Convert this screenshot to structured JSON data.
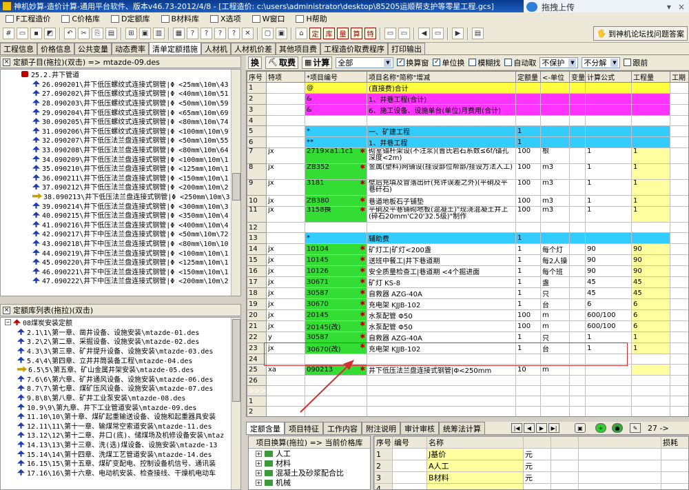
{
  "title_bar": {
    "text": "神机妙算-造价计算-通用平台软件、版本v46.73-2012/4/8 - [工程造价: c:\\users\\administrator\\desktop\\85205运顺帮支护等零星工程.gcs]"
  },
  "cloud": {
    "label": "拖拽上传"
  },
  "menu": [
    "F工程造价",
    "C价格库",
    "D定额库",
    "B材料库",
    "X选项",
    "W窗口",
    "H帮助"
  ],
  "forum_button": "到神机论坛找问题答案",
  "main_tabs": [
    "工程信息",
    "价格信息",
    "公共变量",
    "动态费率",
    "清单定额措施",
    "人材机",
    "人材机价差",
    "其他项目费",
    "工程造价取费程序",
    "打印输出"
  ],
  "active_main_tab": "清单定额措施",
  "left_top": {
    "header": "定额子目(拖拉)(双击) => mtazde-09.des",
    "root": "25.2.井下管道",
    "items": [
      "26.090201\\井下低压螺纹式连接式钢管|Φ <25mm\\10m\\43",
      "27.090202\\井下低压螺纹式连接式钢管|Φ <40mm\\10m\\51",
      "28.090203\\井下低压螺纹式连接式钢管|Φ <50mm\\10m\\59",
      "29.090204\\井下低压螺纹式连接式钢管|Φ <65mm\\10m\\69",
      "30.090205\\井下低压螺纹式连接式钢管|Φ <80mm\\10m\\74",
      "31.090206\\井下低压螺纹式连接式钢管|Φ <100mm\\10m\\9",
      "32.090207\\井下低压法兰盘连接式钢管|Φ <50mm\\10m\\55",
      "33.090208\\井下低压法兰盘连接式钢管|Φ <80mm\\10m\\64",
      "34.090209\\井下低压法兰盘连接式钢管|Φ <100mm\\10m\\1",
      "35.090210\\井下低压法兰盘连接式钢管|Φ <125mm\\10m\\1",
      "36.090211\\井下低压法兰盘连接式钢管|Φ <150mm\\10m\\1",
      "37.090212\\井下低压法兰盘连接式钢管|Φ <200mm\\10m\\2",
      "38.090213\\井下低压法兰盘连接式钢管|Φ <250mm\\10m\\3",
      "39.090214\\井下低压法兰盘连接式钢管|Φ <300mm\\10m\\3",
      "40.090215\\井下低压法兰盘连接式钢管|Φ <350mm\\10m\\4",
      "41.090216\\井下低压法兰盘连接式钢管|Φ <400mm\\10m\\4",
      "42.090217\\井下中压法兰盘连接式钢管|Φ <50mm\\10m\\72",
      "43.090218\\井下中压法兰盘连接式钢管|Φ <80mm\\10m\\10",
      "44.090219\\井下中压法兰盘连接式钢管|Φ <100mm\\10m\\1",
      "45.090220\\井下中压法兰盘连接式钢管|Φ <125mm\\10m\\1",
      "46.090221\\井下中压法兰盘连接式钢管|Φ <150mm\\10m\\1",
      "47.090222\\井下中压法兰盘连接式钢管|Φ <200mm\\10m\\2"
    ],
    "pointer_index": 12
  },
  "left_bottom": {
    "header": "定额库列表(拖拉)(双击)",
    "root": "08煤炭安装定额",
    "items": [
      "2.1\\1\\第一章、凿井设备、设施安装\\mtazde-01.des",
      "3.2\\2\\第二章、采掘设备、设施安装\\mtazde-02.des",
      "4.3\\3\\第三章、矿井提升设备、设施安装\\mtazde-03.des",
      "5.4\\4\\第四章、立井井筒装备工程\\mtazde-04.des",
      "6.5\\5\\第五章、矿山金属井架安装\\mtazde-05.des",
      "7.6\\6\\第六章、矿井通风设备、设施安装\\mtazde-06.des",
      "8.7\\7\\第七章、煤矿压风设备、设施安装\\mtazde-07.des",
      "9.8\\8\\第八章、矿井工业泵安装\\mtazde-08.des",
      "10.9\\9\\第九章、井下工业管道安装\\mtazde-09.des",
      "11.10\\10\\第十章、煤矿起重输送设备、设施和起重器具安装",
      "12.11\\11\\第十一章、输煤常空索道安装\\mtazde-11.des",
      "13.12\\12\\第十二章、井口(底)、储煤场及机修设备安装\\mtaz",
      "14.13\\13\\第十三章、洗(选)煤设备、设施安装\\mtazde-13",
      "15.14\\14\\第十四章、洗煤工艺管道安装\\mtazde-14.des",
      "16.15\\15\\第十五章、煤矿变配电、控制设备机信号、通讯装",
      "17.16\\16\\第十六章、电动机安装、检查接线、干燥机电动车"
    ],
    "pointer_index": 4
  },
  "right_toolbar": {
    "btn_swap": "换",
    "btn_fetch": "取费",
    "btn_calc": "计算",
    "filter_value": "全部",
    "checks": [
      {
        "label": "换算窗",
        "checked": true
      },
      {
        "label": "单位换",
        "checked": true
      },
      {
        "label": "模糊找",
        "checked": false
      },
      {
        "label": "自动取",
        "checked": false
      }
    ],
    "protect": "不保护",
    "split": "不分解",
    "follow": {
      "label": "跟前",
      "checked": false
    }
  },
  "grid": {
    "columns": [
      "序号",
      "特项",
      "*项目编号",
      "项目名称\"简称\"增减",
      "定额量",
      "<-单位",
      "变量",
      "计算公式",
      "工程量",
      "工期"
    ],
    "rows": [
      {
        "n": "1",
        "sp": "",
        "code": "@",
        "name": "(直接费)合计",
        "qty": "",
        "unit": "",
        "var": "",
        "formula": "",
        "amount": "",
        "style": "yel"
      },
      {
        "n": "2",
        "sp": "",
        "code": "&",
        "name": "1、井巷工程(合计)",
        "qty": "",
        "unit": "",
        "var": "",
        "formula": "",
        "amount": "",
        "style": "mag"
      },
      {
        "n": "3",
        "sp": "",
        "code": "&",
        "name": "6、施工设备、设施单台(单位)月费用(合计)",
        "qty": "",
        "unit": "",
        "var": "",
        "formula": "",
        "amount": "",
        "style": "mag"
      },
      {
        "n": "4",
        "sp": "",
        "code": "",
        "name": "",
        "qty": "",
        "unit": "",
        "var": "",
        "formula": "",
        "amount": "",
        "style": ""
      },
      {
        "n": "5",
        "sp": "",
        "code": "*",
        "name": "一、矿建工程",
        "qty": "1",
        "unit": "",
        "var": "",
        "formula": "",
        "amount": "",
        "style": "cyan"
      },
      {
        "n": "6",
        "sp": "",
        "code": "**",
        "name": "1、井巷工程",
        "qty": "1",
        "unit": "",
        "var": "",
        "formula": "",
        "amount": "",
        "style": "cyan"
      },
      {
        "n": "7",
        "sp": "jx",
        "code": "2719×a1.1c1",
        "name": "砌室锚杆架设(不注浆)(普氏岩石系数≤6f/锚孔深度<2m)",
        "qty": "100",
        "unit": "根",
        "var": "",
        "formula": "1",
        "amount": "1",
        "style": "tall"
      },
      {
        "n": "8",
        "sp": "jx",
        "code": "ZB352",
        "name": "金属(塑料)网铺设(挂设部位帮部/挂设方法人工)",
        "qty": "100",
        "unit": "m3",
        "var": "",
        "formula": "1",
        "amount": "1",
        "style": "tall"
      },
      {
        "n": "9",
        "sp": "jx",
        "code": "3181",
        "name": "壁后充填及冒落出矸(充许误差之外)(平硐及平巷矸石)",
        "qty": "100",
        "unit": "m3",
        "var": "",
        "formula": "1",
        "amount": "1",
        "style": "tall"
      },
      {
        "n": "10",
        "sp": "jx",
        "code": "ZB380",
        "name": "巷道地板石子铺垫",
        "qty": "100",
        "unit": "m3",
        "var": "",
        "formula": "1",
        "amount": "1",
        "style": "g"
      },
      {
        "n": "11",
        "sp": "jx",
        "code": "3158换",
        "name": "平硐及平巷铺砌地板(混凝土)\"现浇混凝土井上(碎石20mm'C20'32.5级)\"制作",
        "qty": "100",
        "unit": "m3",
        "var": "",
        "formula": "1",
        "amount": "1",
        "style": "tall"
      },
      {
        "n": "12",
        "sp": "",
        "code": "",
        "name": "",
        "qty": "",
        "unit": "",
        "var": "",
        "formula": "",
        "amount": "",
        "style": ""
      },
      {
        "n": "13",
        "sp": "",
        "code": "*",
        "name": "辅助费",
        "qty": "1",
        "unit": "",
        "var": "",
        "formula": "",
        "amount": "",
        "style": "cyan"
      },
      {
        "n": "14",
        "sp": "jx",
        "code": "10104",
        "name": "矿灯工|矿灯<200盏",
        "qty": "1",
        "unit": "每个灯",
        "var": "",
        "formula": "90",
        "amount": "90",
        "style": "g"
      },
      {
        "n": "15",
        "sp": "jx",
        "code": "10145",
        "name": "送班中餐工|井下巷道期",
        "qty": "1",
        "unit": "每2人操",
        "var": "",
        "formula": "90",
        "amount": "90",
        "style": "g"
      },
      {
        "n": "16",
        "sp": "jx",
        "code": "10126",
        "name": "安全质量检查工|巷道期 <4个掘进面",
        "qty": "1",
        "unit": "每个班",
        "var": "",
        "formula": "90",
        "amount": "90",
        "style": "g"
      },
      {
        "n": "17",
        "sp": "jx",
        "code": "30671",
        "name": "矿灯 KS-8",
        "qty": "1",
        "unit": "盏",
        "var": "",
        "formula": "45",
        "amount": "45",
        "style": "g"
      },
      {
        "n": "18",
        "sp": "jx",
        "code": "30587",
        "name": "自救器 AZG-40A",
        "qty": "1",
        "unit": "只",
        "var": "",
        "formula": "45",
        "amount": "45",
        "style": "g"
      },
      {
        "n": "19",
        "sp": "jx",
        "code": "30670",
        "name": "充电架 KJJB-102",
        "qty": "1",
        "unit": "台",
        "var": "",
        "formula": "6",
        "amount": "6",
        "style": "g"
      },
      {
        "n": "20",
        "sp": "jx",
        "code": "20145",
        "name": "水泵配管 Φ50",
        "qty": "100",
        "unit": "m",
        "var": "",
        "formula": "600/100",
        "amount": "6",
        "style": "g"
      },
      {
        "n": "21",
        "sp": "jx",
        "code": "20145(改)",
        "name": "水泵配管 Φ50",
        "qty": "100",
        "unit": "m",
        "var": "",
        "formula": "600/100",
        "amount": "6",
        "style": "g"
      },
      {
        "n": "22",
        "sp": "y",
        "code": "30587",
        "name": "自救器 AZG-40A",
        "qty": "1",
        "unit": "只",
        "var": "",
        "formula": "1",
        "amount": "1",
        "style": "g"
      },
      {
        "n": "23",
        "sp": "jx",
        "code": "30670(改)",
        "name": "充电架 KJJB-102",
        "qty": "1",
        "unit": "台",
        "var": "",
        "formula": "1",
        "amount": "1",
        "style": "g"
      },
      {
        "n": "24",
        "sp": "",
        "code": "",
        "name": "",
        "qty": "",
        "unit": "",
        "var": "",
        "formula": "",
        "amount": "",
        "style": ""
      },
      {
        "n": "25",
        "sp": "xa",
        "code": "090213",
        "name": "井下低压法兰盘连接式钢管|Φ<250mm",
        "qty": "10",
        "unit": "m",
        "var": "",
        "formula": "",
        "amount": "",
        "style": "g"
      },
      {
        "n": "26",
        "sp": "",
        "code": "",
        "name": "",
        "qty": "",
        "unit": "",
        "var": "",
        "formula": "",
        "amount": "",
        "style": ""
      },
      {
        "n": ">>>>",
        "sp": "",
        "code": "",
        "name": "",
        "qty": "",
        "unit": "",
        "var": "",
        "formula": "",
        "amount": "",
        "style": "sel"
      },
      {
        "n": "1",
        "sp": "",
        "code": "",
        "name": "",
        "qty": "",
        "unit": "",
        "var": "",
        "formula": "",
        "amount": "",
        "style": ""
      },
      {
        "n": "2",
        "sp": "",
        "code": "",
        "name": "",
        "qty": "",
        "unit": "",
        "var": "",
        "formula": "",
        "amount": "",
        "style": ""
      },
      {
        "n": "3",
        "sp": "",
        "code": "",
        "name": "",
        "qty": "",
        "unit": "",
        "var": "",
        "formula": "",
        "amount": "",
        "style": ""
      },
      {
        "n": "4",
        "sp": "",
        "code": "",
        "name": "",
        "qty": "",
        "unit": "",
        "var": "",
        "formula": "",
        "amount": "",
        "style": ""
      },
      {
        "n": "5",
        "sp": "",
        "code": "",
        "name": "",
        "qty": "",
        "unit": "",
        "var": "",
        "formula": "",
        "amount": "",
        "style": ""
      }
    ]
  },
  "bottom_tabs": [
    "定额含量",
    "项目特征",
    "工作内容",
    "附注说明",
    "审计审核",
    "统筹法计算"
  ],
  "bottom_counter": "27 ->",
  "bottom_left": {
    "header": "项目换算(拖拉) => 当前价格库",
    "items": [
      "人工",
      "材料",
      "混凝土及砂浆配合比",
      "机械"
    ]
  },
  "bottom_right": {
    "columns": [
      "序号",
      "编号",
      "名称",
      "",
      "",
      "",
      "损耗"
    ],
    "rows": [
      [
        "1",
        "",
        "J基价"
      ],
      [
        "2",
        "",
        "A人工"
      ],
      [
        "3",
        "",
        "B材料"
      ],
      [
        "4",
        "",
        "",
        ""
      ]
    ],
    "side": [
      "元",
      "元",
      "元"
    ]
  },
  "colors": {
    "yellow": "#ffff40",
    "magenta": "#ff33ff",
    "cyan": "#33ccff",
    "green": "#33dd33",
    "highlight": "#d03030"
  }
}
